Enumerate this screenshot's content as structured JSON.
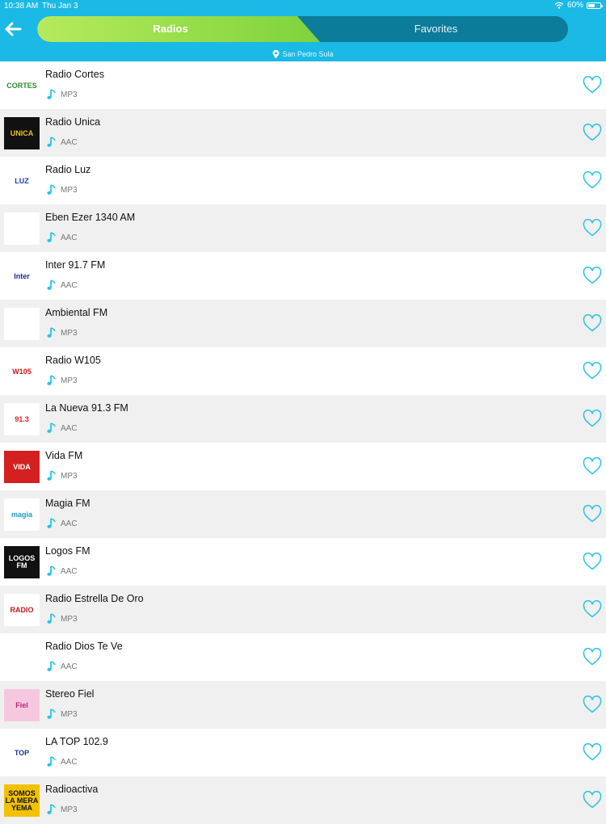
{
  "status_bar": {
    "time": "10:38 AM",
    "date": "Thu Jan 3",
    "battery": "60%",
    "battery_level": 0.6
  },
  "tabs": {
    "radios": "Radios",
    "favorites": "Favorites"
  },
  "location": "San Pedro Sula",
  "stations": [
    {
      "name": "Radio Cortes",
      "format": "MP3",
      "logo_text": "CORTES",
      "logo_bg": "#ffffff",
      "logo_fg": "#2e8b2e"
    },
    {
      "name": "Radio Unica",
      "format": "AAC",
      "logo_text": "UNICA",
      "logo_bg": "#111111",
      "logo_fg": "#e8c020"
    },
    {
      "name": "Radio Luz",
      "format": "MP3",
      "logo_text": "LUZ",
      "logo_bg": "#ffffff",
      "logo_fg": "#1a3ea8"
    },
    {
      "name": "Eben Ezer 1340 AM",
      "format": "AAC",
      "logo_text": "",
      "logo_bg": "#ffffff",
      "logo_fg": "#2d8a2d"
    },
    {
      "name": "Inter 91.7 FM",
      "format": "AAC",
      "logo_text": "Inter",
      "logo_bg": "#ffffff",
      "logo_fg": "#1a2a8a"
    },
    {
      "name": "Ambiental FM",
      "format": "MP3",
      "logo_text": "",
      "logo_bg": "#ffffff",
      "logo_fg": "#8a1a4a"
    },
    {
      "name": "Radio W105",
      "format": "MP3",
      "logo_text": "W105",
      "logo_bg": "#ffffff",
      "logo_fg": "#d01a1a"
    },
    {
      "name": "La Nueva 91.3 FM",
      "format": "AAC",
      "logo_text": "91.3",
      "logo_bg": "#ffffff",
      "logo_fg": "#e02020"
    },
    {
      "name": "Vida FM",
      "format": "MP3",
      "logo_text": "VIDA",
      "logo_bg": "#d42020",
      "logo_fg": "#ffffff"
    },
    {
      "name": "Magia FM",
      "format": "AAC",
      "logo_text": "magia",
      "logo_bg": "#ffffff",
      "logo_fg": "#1a9ad0"
    },
    {
      "name": "Logos FM",
      "format": "AAC",
      "logo_text": "LOGOS FM",
      "logo_bg": "#111111",
      "logo_fg": "#ffffff"
    },
    {
      "name": "Radio Estrella De Oro",
      "format": "MP3",
      "logo_text": "RADIO",
      "logo_bg": "#ffffff",
      "logo_fg": "#c01a1a"
    },
    {
      "name": "Radio Dios Te Ve",
      "format": "AAC",
      "logo_text": "",
      "logo_bg": "#ffffff",
      "logo_fg": "#1a3a7a"
    },
    {
      "name": "Stereo Fiel",
      "format": "MP3",
      "logo_text": "Fiel",
      "logo_bg": "#f6c8e0",
      "logo_fg": "#c0207a"
    },
    {
      "name": "LA TOP 102.9",
      "format": "AAC",
      "logo_text": "TOP",
      "logo_bg": "#ffffff",
      "logo_fg": "#1a3a8a"
    },
    {
      "name": "Radioactiva",
      "format": "MP3",
      "logo_text": "SOMOS LA MERA YEMA",
      "logo_bg": "#f2c200",
      "logo_fg": "#111111"
    }
  ],
  "colors": {
    "header": "#1ab9e6",
    "accent": "#28c3e6",
    "segment_active": "#8fdc45",
    "segment_inactive": "#0d7b9a"
  },
  "icons": {
    "back": "arrow-left-icon",
    "location": "map-pin-icon",
    "format": "music-note-icon",
    "favorite": "heart-outline-icon"
  }
}
